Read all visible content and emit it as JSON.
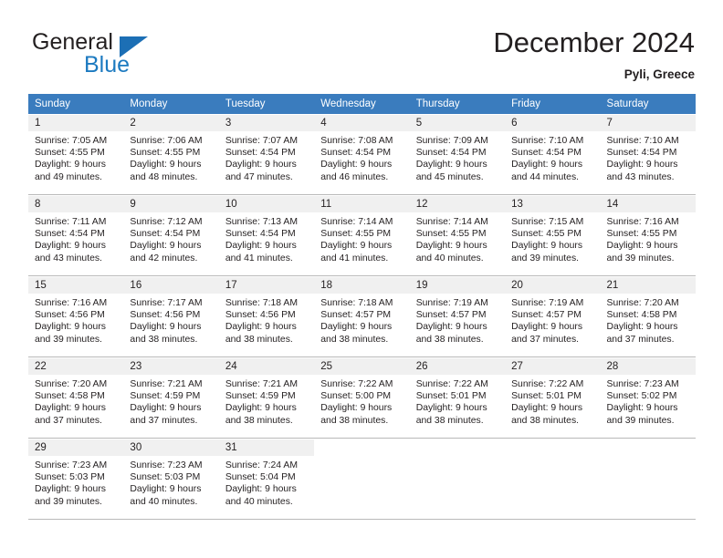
{
  "brand": {
    "name_part1": "General",
    "name_part2": "Blue",
    "triangle_color": "#1c6fb5",
    "blue_color": "#1c7ac0"
  },
  "header": {
    "title": "December 2024",
    "location": "Pyli, Greece"
  },
  "calendar": {
    "header_bg": "#3a7cbe",
    "day_band_bg": "#f0f0f0",
    "weekday_headers": [
      "Sunday",
      "Monday",
      "Tuesday",
      "Wednesday",
      "Thursday",
      "Friday",
      "Saturday"
    ],
    "weeks": [
      [
        {
          "day": "1",
          "sunrise": "Sunrise: 7:05 AM",
          "sunset": "Sunset: 4:55 PM",
          "daylight_1": "Daylight: 9 hours",
          "daylight_2": "and 49 minutes."
        },
        {
          "day": "2",
          "sunrise": "Sunrise: 7:06 AM",
          "sunset": "Sunset: 4:55 PM",
          "daylight_1": "Daylight: 9 hours",
          "daylight_2": "and 48 minutes."
        },
        {
          "day": "3",
          "sunrise": "Sunrise: 7:07 AM",
          "sunset": "Sunset: 4:54 PM",
          "daylight_1": "Daylight: 9 hours",
          "daylight_2": "and 47 minutes."
        },
        {
          "day": "4",
          "sunrise": "Sunrise: 7:08 AM",
          "sunset": "Sunset: 4:54 PM",
          "daylight_1": "Daylight: 9 hours",
          "daylight_2": "and 46 minutes."
        },
        {
          "day": "5",
          "sunrise": "Sunrise: 7:09 AM",
          "sunset": "Sunset: 4:54 PM",
          "daylight_1": "Daylight: 9 hours",
          "daylight_2": "and 45 minutes."
        },
        {
          "day": "6",
          "sunrise": "Sunrise: 7:10 AM",
          "sunset": "Sunset: 4:54 PM",
          "daylight_1": "Daylight: 9 hours",
          "daylight_2": "and 44 minutes."
        },
        {
          "day": "7",
          "sunrise": "Sunrise: 7:10 AM",
          "sunset": "Sunset: 4:54 PM",
          "daylight_1": "Daylight: 9 hours",
          "daylight_2": "and 43 minutes."
        }
      ],
      [
        {
          "day": "8",
          "sunrise": "Sunrise: 7:11 AM",
          "sunset": "Sunset: 4:54 PM",
          "daylight_1": "Daylight: 9 hours",
          "daylight_2": "and 43 minutes."
        },
        {
          "day": "9",
          "sunrise": "Sunrise: 7:12 AM",
          "sunset": "Sunset: 4:54 PM",
          "daylight_1": "Daylight: 9 hours",
          "daylight_2": "and 42 minutes."
        },
        {
          "day": "10",
          "sunrise": "Sunrise: 7:13 AM",
          "sunset": "Sunset: 4:54 PM",
          "daylight_1": "Daylight: 9 hours",
          "daylight_2": "and 41 minutes."
        },
        {
          "day": "11",
          "sunrise": "Sunrise: 7:14 AM",
          "sunset": "Sunset: 4:55 PM",
          "daylight_1": "Daylight: 9 hours",
          "daylight_2": "and 41 minutes."
        },
        {
          "day": "12",
          "sunrise": "Sunrise: 7:14 AM",
          "sunset": "Sunset: 4:55 PM",
          "daylight_1": "Daylight: 9 hours",
          "daylight_2": "and 40 minutes."
        },
        {
          "day": "13",
          "sunrise": "Sunrise: 7:15 AM",
          "sunset": "Sunset: 4:55 PM",
          "daylight_1": "Daylight: 9 hours",
          "daylight_2": "and 39 minutes."
        },
        {
          "day": "14",
          "sunrise": "Sunrise: 7:16 AM",
          "sunset": "Sunset: 4:55 PM",
          "daylight_1": "Daylight: 9 hours",
          "daylight_2": "and 39 minutes."
        }
      ],
      [
        {
          "day": "15",
          "sunrise": "Sunrise: 7:16 AM",
          "sunset": "Sunset: 4:56 PM",
          "daylight_1": "Daylight: 9 hours",
          "daylight_2": "and 39 minutes."
        },
        {
          "day": "16",
          "sunrise": "Sunrise: 7:17 AM",
          "sunset": "Sunset: 4:56 PM",
          "daylight_1": "Daylight: 9 hours",
          "daylight_2": "and 38 minutes."
        },
        {
          "day": "17",
          "sunrise": "Sunrise: 7:18 AM",
          "sunset": "Sunset: 4:56 PM",
          "daylight_1": "Daylight: 9 hours",
          "daylight_2": "and 38 minutes."
        },
        {
          "day": "18",
          "sunrise": "Sunrise: 7:18 AM",
          "sunset": "Sunset: 4:57 PM",
          "daylight_1": "Daylight: 9 hours",
          "daylight_2": "and 38 minutes."
        },
        {
          "day": "19",
          "sunrise": "Sunrise: 7:19 AM",
          "sunset": "Sunset: 4:57 PM",
          "daylight_1": "Daylight: 9 hours",
          "daylight_2": "and 38 minutes."
        },
        {
          "day": "20",
          "sunrise": "Sunrise: 7:19 AM",
          "sunset": "Sunset: 4:57 PM",
          "daylight_1": "Daylight: 9 hours",
          "daylight_2": "and 37 minutes."
        },
        {
          "day": "21",
          "sunrise": "Sunrise: 7:20 AM",
          "sunset": "Sunset: 4:58 PM",
          "daylight_1": "Daylight: 9 hours",
          "daylight_2": "and 37 minutes."
        }
      ],
      [
        {
          "day": "22",
          "sunrise": "Sunrise: 7:20 AM",
          "sunset": "Sunset: 4:58 PM",
          "daylight_1": "Daylight: 9 hours",
          "daylight_2": "and 37 minutes."
        },
        {
          "day": "23",
          "sunrise": "Sunrise: 7:21 AM",
          "sunset": "Sunset: 4:59 PM",
          "daylight_1": "Daylight: 9 hours",
          "daylight_2": "and 37 minutes."
        },
        {
          "day": "24",
          "sunrise": "Sunrise: 7:21 AM",
          "sunset": "Sunset: 4:59 PM",
          "daylight_1": "Daylight: 9 hours",
          "daylight_2": "and 38 minutes."
        },
        {
          "day": "25",
          "sunrise": "Sunrise: 7:22 AM",
          "sunset": "Sunset: 5:00 PM",
          "daylight_1": "Daylight: 9 hours",
          "daylight_2": "and 38 minutes."
        },
        {
          "day": "26",
          "sunrise": "Sunrise: 7:22 AM",
          "sunset": "Sunset: 5:01 PM",
          "daylight_1": "Daylight: 9 hours",
          "daylight_2": "and 38 minutes."
        },
        {
          "day": "27",
          "sunrise": "Sunrise: 7:22 AM",
          "sunset": "Sunset: 5:01 PM",
          "daylight_1": "Daylight: 9 hours",
          "daylight_2": "and 38 minutes."
        },
        {
          "day": "28",
          "sunrise": "Sunrise: 7:23 AM",
          "sunset": "Sunset: 5:02 PM",
          "daylight_1": "Daylight: 9 hours",
          "daylight_2": "and 39 minutes."
        }
      ],
      [
        {
          "day": "29",
          "sunrise": "Sunrise: 7:23 AM",
          "sunset": "Sunset: 5:03 PM",
          "daylight_1": "Daylight: 9 hours",
          "daylight_2": "and 39 minutes."
        },
        {
          "day": "30",
          "sunrise": "Sunrise: 7:23 AM",
          "sunset": "Sunset: 5:03 PM",
          "daylight_1": "Daylight: 9 hours",
          "daylight_2": "and 40 minutes."
        },
        {
          "day": "31",
          "sunrise": "Sunrise: 7:24 AM",
          "sunset": "Sunset: 5:04 PM",
          "daylight_1": "Daylight: 9 hours",
          "daylight_2": "and 40 minutes."
        },
        {
          "day": "",
          "sunrise": "",
          "sunset": "",
          "daylight_1": "",
          "daylight_2": ""
        },
        {
          "day": "",
          "sunrise": "",
          "sunset": "",
          "daylight_1": "",
          "daylight_2": ""
        },
        {
          "day": "",
          "sunrise": "",
          "sunset": "",
          "daylight_1": "",
          "daylight_2": ""
        },
        {
          "day": "",
          "sunrise": "",
          "sunset": "",
          "daylight_1": "",
          "daylight_2": ""
        }
      ]
    ]
  }
}
